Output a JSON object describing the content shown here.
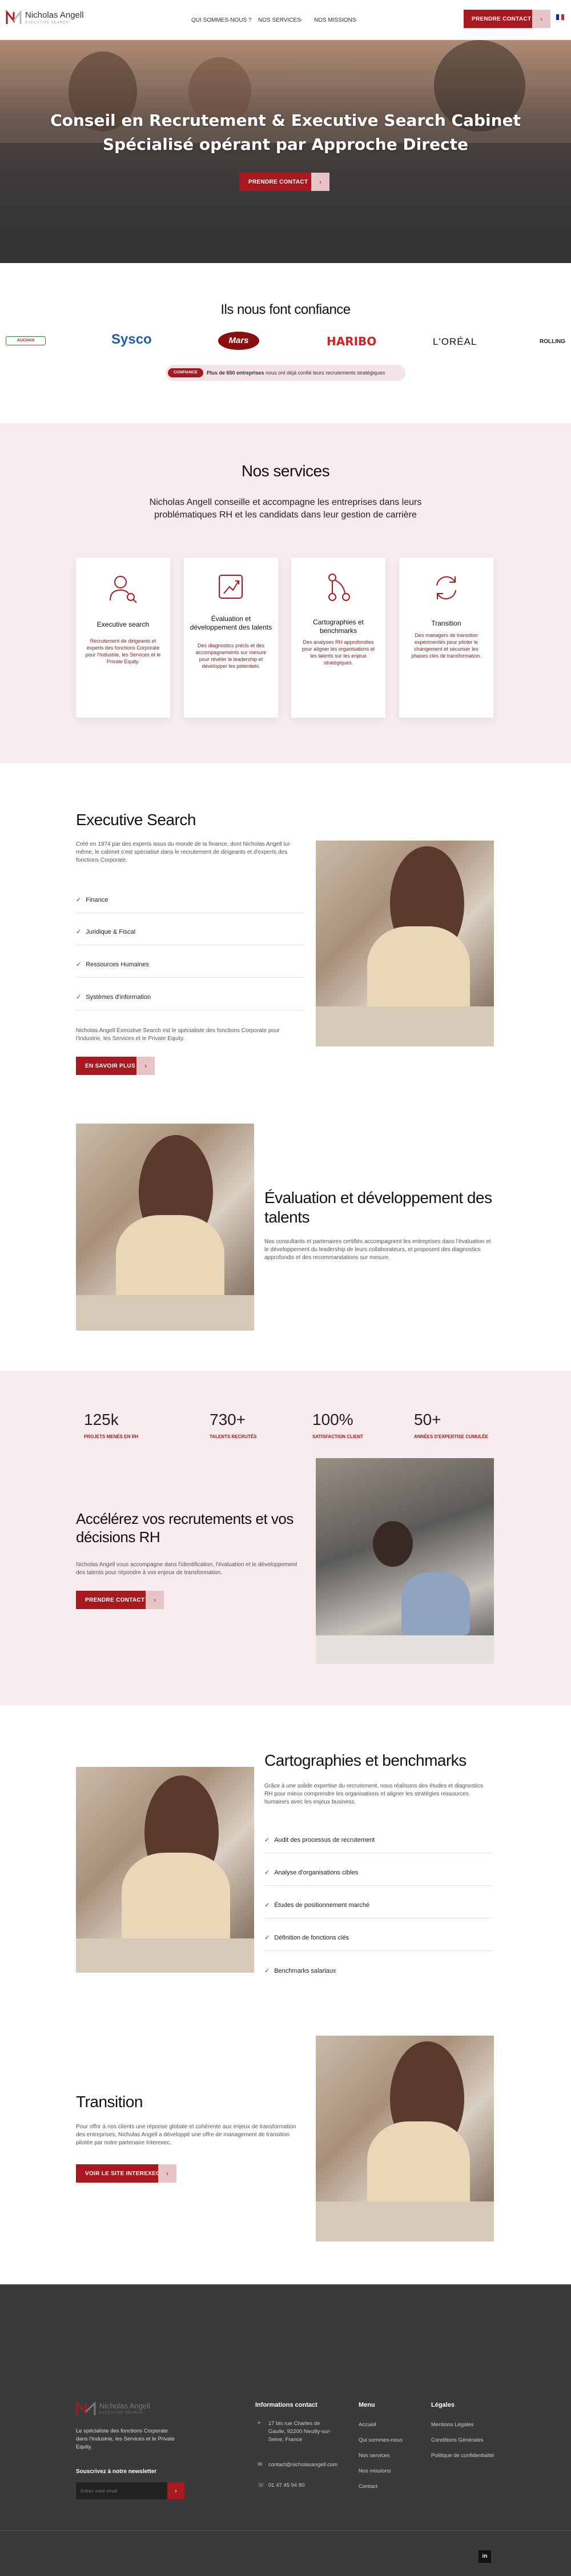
{
  "header": {
    "brand": "Nicholas Angell",
    "brand_tagline": "EXECUTIVE SEARCH",
    "nav": [
      "QUI SOMMES-NOUS ?",
      "NOS SERVICES",
      "NOS MISSIONS"
    ],
    "cta": "PRENDRE CONTACT",
    "lang": "FR"
  },
  "hero": {
    "title_line1": "Conseil en Recrutement & Executive Search Cabinet",
    "title_line2": "Spécialisé opérant par Approche Directe",
    "cta": "PRENDRE CONTACT"
  },
  "trust": {
    "title": "Ils nous font confiance",
    "logos": [
      "Sysco",
      "Mars",
      "HARIBO",
      "L'ORÉAL",
      "ROLLING"
    ],
    "badge": "CONFIANCE",
    "note_bold": "Plus de 650 entreprises",
    "note_rest": "nous ont déjà confié leurs recrutements stratégiques"
  },
  "services": {
    "title": "Nos services",
    "subtitle": "Nicholas Angell conseille et accompagne les entreprises dans leurs problématiques RH et les candidats dans leur gestion de carrière",
    "cards": [
      {
        "title": "Executive search",
        "desc": "Recrutement de dirigeants et experts des fonctions Corporate pour l'Industrie, les Services et le Private Equity."
      },
      {
        "title": "Évaluation et développement des talents",
        "desc": "Des diagnostics précis et des accompagnements sur mesure pour révéler le leadership et développer les potentiels."
      },
      {
        "title": "Cartographies et benchmarks",
        "desc": "Des analyses RH approfondies pour aligner les organisations et les talents sur les enjeux stratégiques."
      },
      {
        "title": "Transition",
        "desc": "Des managers de transition expérimentés pour piloter le changement et sécuriser les phases clés de transformation."
      }
    ]
  },
  "exec": {
    "title": "Executive Search",
    "intro": "Créé en 1974 par des experts issus du monde de la finance, dont Nicholas Angell lui-même, le cabinet s'est spécialisé dans le recrutement de dirigeants et d'experts des fonctions Corporate.",
    "items": [
      "Finance",
      "Juridique & Fiscal",
      "Ressources Humaines",
      "Systèmes d'information"
    ],
    "outro": "Nicholas Angell Executive Search est le spécialiste des fonctions Corporate pour l'Industrie, les Services et le Private Equity.",
    "cta": "EN SAVOIR PLUS"
  },
  "talents": {
    "title": "Évaluation et développement des talents",
    "text": "Nos consultants et partenaires certifiés accompagnent les entreprises dans l'évaluation et le développement du leadership de leurs collaborateurs, et proposent des diagnostics approfondis et des recommandations sur mesure."
  },
  "stats": [
    {
      "value": "125k",
      "label": "PROJETS MENÉS EN RH"
    },
    {
      "value": "730+",
      "label": "TALENTS RECRUTÉS"
    },
    {
      "value": "100%",
      "label": "SATISFACTION CLIENT"
    },
    {
      "value": "50+",
      "label": "ANNÉES D'EXPERTISE CUMULÉE"
    }
  ],
  "accelerate": {
    "title_line1": "Accélérez vos recrutements et vos",
    "title_line2": "décisions RH",
    "text": "Nicholas Angell vous accompagne dans l'identification, l'évaluation et le développement des talents pour répondre à vos enjeux de transformation.",
    "cta": "PRENDRE CONTACT"
  },
  "carto": {
    "title": "Cartographies et benchmarks",
    "text": "Grâce à une solide expertise du recrutement, nous réalisons des études et diagnostics RH pour mieux comprendre les organisations et aligner les stratégies ressources humaines avec les enjeux business.",
    "items": [
      "Audit des processus de recrutement",
      "Analyse d'organisations cibles",
      "Études de positionnement marché",
      "Définition de fonctions clés",
      "Benchmarks salariaux"
    ]
  },
  "transition": {
    "title": "Transition",
    "text": "Pour offrir à nos clients une réponse globale et cohérente aux enjeux de transformation des entreprises, Nicholas Angell a développé une offre de management de transition pilotée par notre partenaire Interexec.",
    "cta": "VOIR LE SITE INTEREXEC"
  },
  "footer": {
    "brand": "Nicholas Angell",
    "brand_tagline": "EXECUTIVE SEARCH",
    "about": "Le spécialiste des fonctions Corporate dans l'Industrie, les Services et le Private Equity.",
    "newsletter_title": "Souscrivez à notre newsletter",
    "newsletter_placeholder": "Entrez votre email",
    "contact_title": "Informations contact",
    "address": "17 bis rue Charles de Gaulle, 92200 Neuilly-sur-Seine, France",
    "email": "contact@nicholasangell.com",
    "phone": "01 47 45 94 80",
    "menu_title": "Menu",
    "menu": [
      "Accueil",
      "Qui sommes-nous",
      "Nos services",
      "Nos missions",
      "Contact"
    ],
    "legal_title": "Légales",
    "legal": [
      "Mentions Légales",
      "Conditions Générales",
      "Politique de confidentialité"
    ],
    "social": "in"
  }
}
